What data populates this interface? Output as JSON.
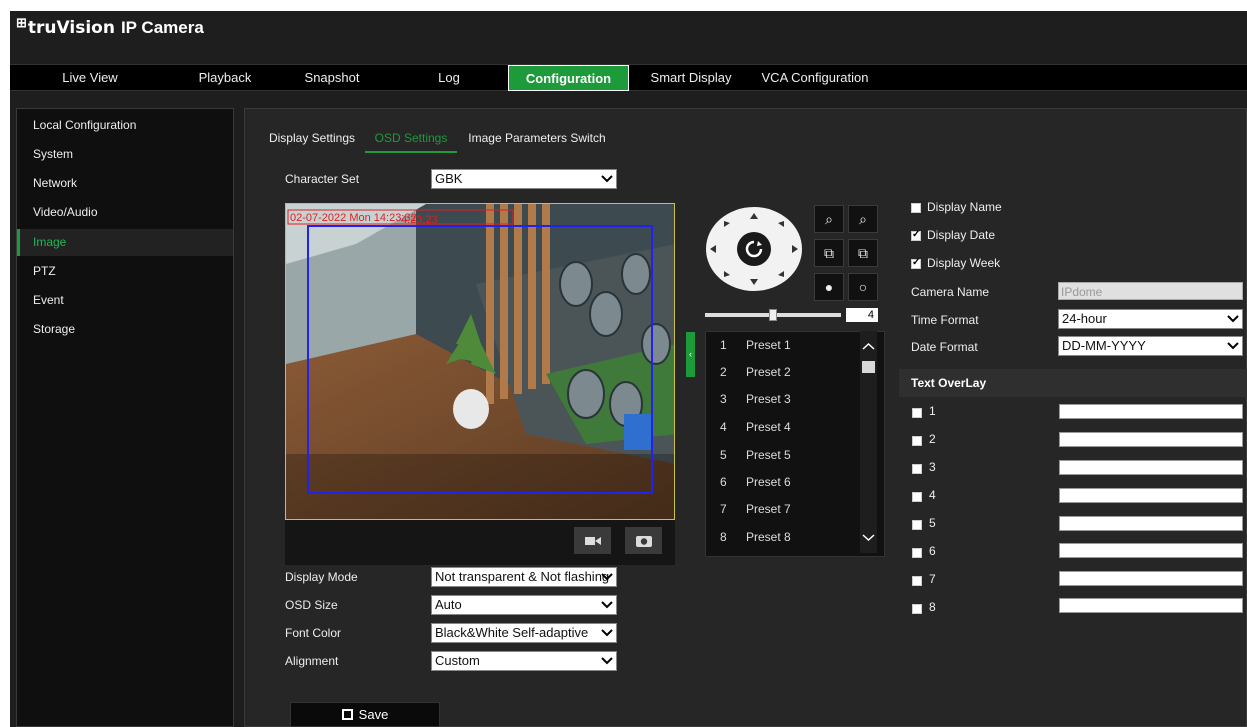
{
  "app": {
    "title_mark": "⊞",
    "title_brand": "truVision",
    "title_product": "IP Camera"
  },
  "nav": {
    "items": [
      "Live View",
      "Playback",
      "Snapshot",
      "Log",
      "Configuration",
      "Smart Display",
      "VCA Configuration"
    ],
    "active": "Configuration"
  },
  "sidebar": {
    "items": [
      "Local Configuration",
      "System",
      "Network",
      "Video/Audio",
      "Image",
      "PTZ",
      "Event",
      "Storage"
    ],
    "active": "Image"
  },
  "tabs": {
    "items": [
      "Display Settings",
      "OSD Settings",
      "Image Parameters Switch"
    ],
    "active": "OSD Settings"
  },
  "form": {
    "character_set_label": "Character Set",
    "character_set_value": "GBK",
    "display_mode_label": "Display Mode",
    "display_mode_value": "Not transparent & Not flashing",
    "osd_size_label": "OSD Size",
    "osd_size_value": "Auto",
    "font_color_label": "Font Color",
    "font_color_value": "Black&White Self-adaptive",
    "alignment_label": "Alignment",
    "alignment_value": "Custom",
    "save_label": "Save"
  },
  "video": {
    "osd_date_text": "02-07-2022 Mon 14:23:32",
    "osd_overlap_text": "4:23:23"
  },
  "ptz": {
    "speed_value": "4",
    "speed_fraction": 0.5,
    "presets": [
      {
        "num": "1",
        "name": "Preset 1"
      },
      {
        "num": "2",
        "name": "Preset 2"
      },
      {
        "num": "3",
        "name": "Preset 3"
      },
      {
        "num": "4",
        "name": "Preset 4"
      },
      {
        "num": "5",
        "name": "Preset 5"
      },
      {
        "num": "6",
        "name": "Preset 6"
      },
      {
        "num": "7",
        "name": "Preset 7"
      },
      {
        "num": "8",
        "name": "Preset 8"
      }
    ]
  },
  "osd": {
    "display_name_label": "Display Name",
    "display_name_checked": false,
    "display_date_label": "Display Date",
    "display_date_checked": true,
    "display_week_label": "Display Week",
    "display_week_checked": true,
    "camera_name_label": "Camera Name",
    "camera_name_value": "IPdome",
    "time_format_label": "Time Format",
    "time_format_value": "24-hour",
    "date_format_label": "Date Format",
    "date_format_value": "DD-MM-YYYY",
    "text_overlay_title": "Text OverLay",
    "overlays": [
      "1",
      "2",
      "3",
      "4",
      "5",
      "6",
      "7",
      "8"
    ]
  },
  "colors": {
    "accent": "#1d9a3a",
    "osd_red": "#e02020",
    "roi_blue": "#2222ee",
    "frame_yellow": "#c9c14a"
  }
}
